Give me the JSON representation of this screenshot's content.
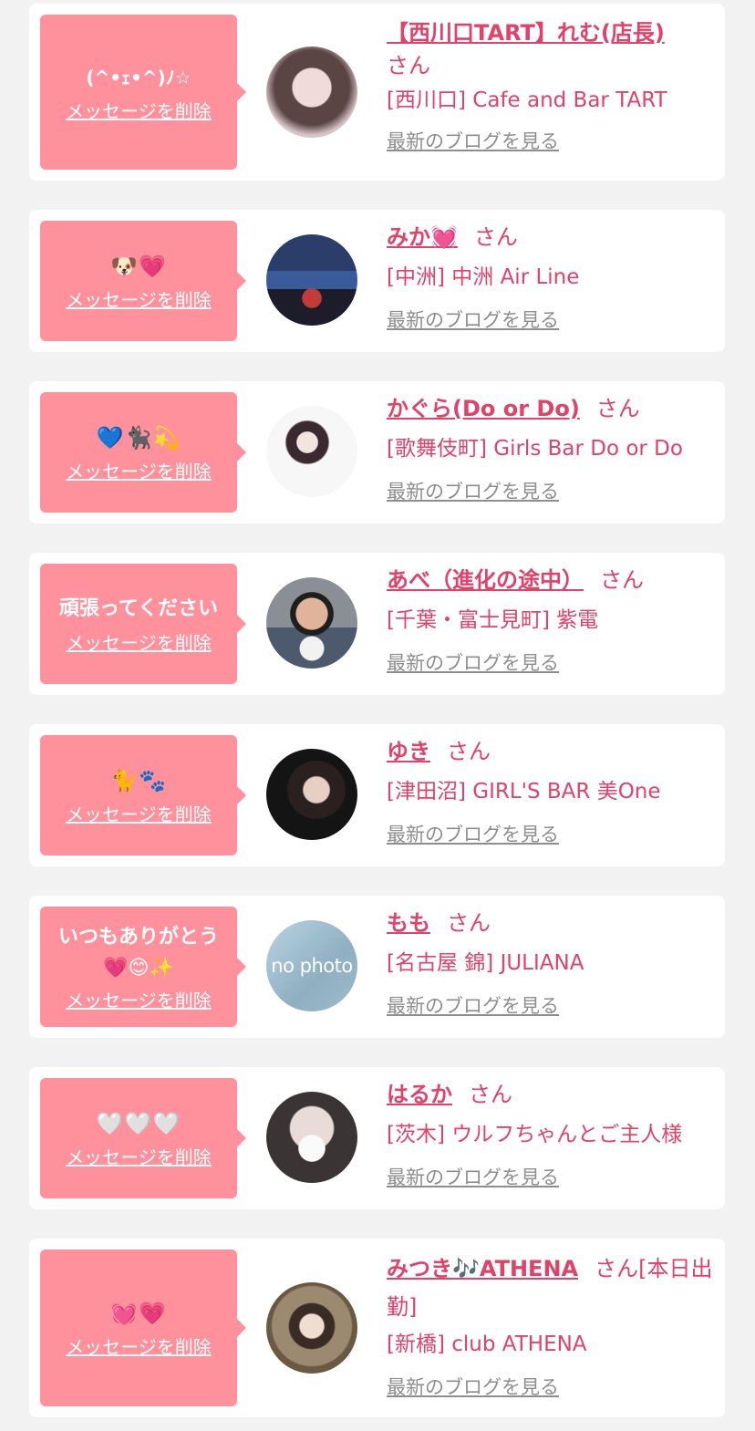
{
  "rows": [
    {
      "message": "(^•ｪ•^)ﾉ☆",
      "delete_label": "メッセージを削除",
      "name": "【西川口TART】れむ(店長)",
      "san": "さん",
      "shop": "[西川口] Cafe and Bar TART",
      "blog": "最新のブログを見る"
    },
    {
      "message": "🐶💗",
      "delete_label": "メッセージを削除",
      "name": "みか💓",
      "san": "さん",
      "shop": "[中洲] 中洲 Air Line",
      "blog": "最新のブログを見る"
    },
    {
      "message": "💙🐈‍⬛💫",
      "delete_label": "メッセージを削除",
      "name": "かぐら(Do or Do)",
      "san": "さん",
      "shop": "[歌舞伎町] Girls Bar Do or Do",
      "blog": "最新のブログを見る"
    },
    {
      "message": "頑張ってください",
      "delete_label": "メッセージを削除",
      "name": "あべ（進化の途中）",
      "san": "さん",
      "shop": "[千葉・富士見町] 紫電",
      "blog": "最新のブログを見る"
    },
    {
      "message": "🐈🐾",
      "delete_label": "メッセージを削除",
      "name": "ゆき",
      "san": "さん",
      "shop": "[津田沼] GIRL'S BAR 美One",
      "blog": "最新のブログを見る"
    },
    {
      "message": "いつもありがとう\n💗😊✨",
      "delete_label": "メッセージを削除",
      "name": "もも",
      "san": "さん",
      "shop": "[名古屋 錦] JULIANA",
      "blog": "最新のブログを見る",
      "avatar_text": "no photo"
    },
    {
      "message": "🤍🤍🤍",
      "delete_label": "メッセージを削除",
      "name": "はるか",
      "san": "さん",
      "shop": "[茨木] ウルフちゃんとご主人様",
      "blog": "最新のブログを見る"
    },
    {
      "message": "💓💗",
      "delete_label": "メッセージを削除",
      "name": "みつき🎶ATHENA",
      "san": "さん[本日出勤]",
      "shop": "[新橋] club ATHENA",
      "blog": "最新のブログを見る"
    }
  ],
  "colors": {
    "accent": "#e0426a",
    "bubble": "#fe919c",
    "muted": "#8e8e8e",
    "background": "#f2f2f2"
  }
}
